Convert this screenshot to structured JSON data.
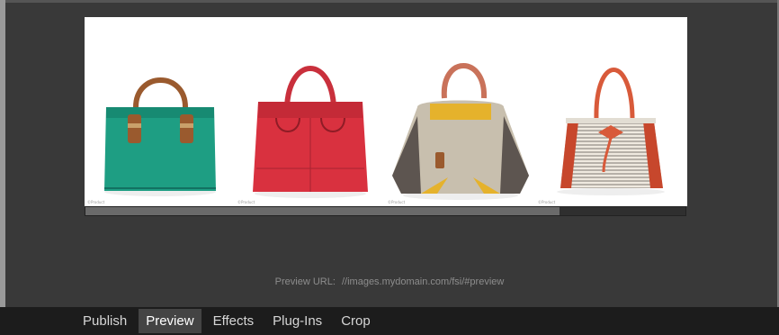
{
  "preview": {
    "url_label": "Preview URL:",
    "url_value": "//images.mydomain.com/fsi/#preview",
    "progress": 0.79
  },
  "images": [
    {
      "watermark": "©Product",
      "color": "#1e9e83"
    },
    {
      "watermark": "©Product",
      "color": "#d9313f"
    },
    {
      "watermark": "©Product",
      "color": "#c8bfae"
    },
    {
      "watermark": "©Product",
      "color": "#e9e4dc"
    }
  ],
  "tabs": [
    {
      "label": "Publish",
      "active": false
    },
    {
      "label": "Preview",
      "active": true
    },
    {
      "label": "Effects",
      "active": false
    },
    {
      "label": "Plug-Ins",
      "active": false
    },
    {
      "label": "Crop",
      "active": false
    }
  ]
}
